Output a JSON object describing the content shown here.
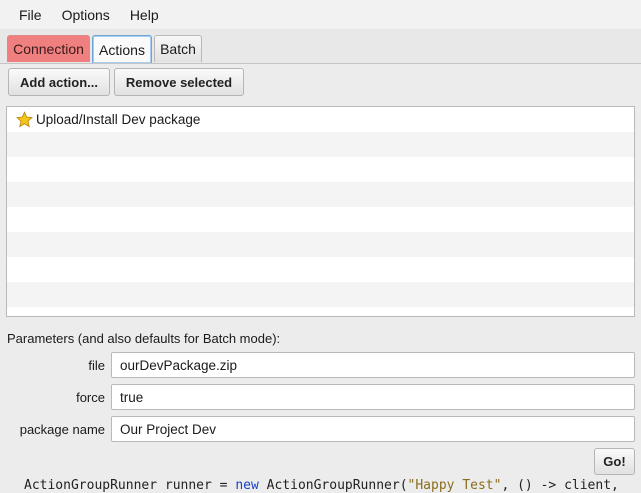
{
  "menu": {
    "items": [
      "File",
      "Options",
      "Help"
    ]
  },
  "tabs": [
    {
      "label": "Connection",
      "color": "#f08080"
    },
    {
      "label": "Actions",
      "selected": true
    },
    {
      "label": "Batch"
    }
  ],
  "toolbar": {
    "add_label": "Add action...",
    "remove_label": "Remove selected"
  },
  "actions_list": {
    "items": [
      {
        "label": "Upload/Install Dev package",
        "icon": "star-icon"
      }
    ]
  },
  "parameters": {
    "title": "Parameters (and also defaults for Batch mode):",
    "fields": [
      {
        "label": "file",
        "value": "ourDevPackage.zip"
      },
      {
        "label": "force",
        "value": "true"
      },
      {
        "label": "package name",
        "value": "Our Project Dev"
      }
    ]
  },
  "go_label": "Go!",
  "background_code": {
    "prefix": "ActionGroupRunner runner = ",
    "keyword": "new",
    "middle": " ActionGroupRunner(",
    "string": "\"Happy Test\"",
    "suffix": ", () -> client,"
  }
}
